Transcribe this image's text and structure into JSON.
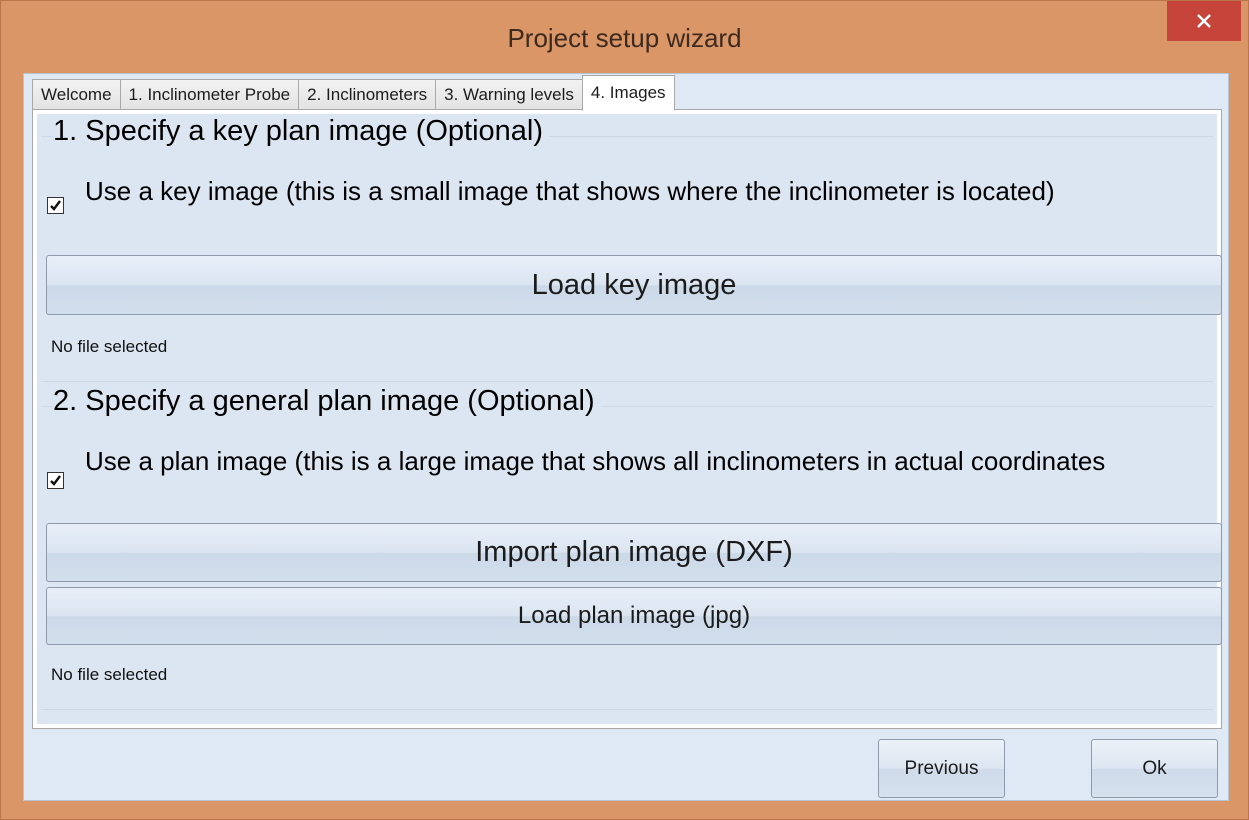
{
  "window": {
    "title": "Project setup wizard",
    "close_label": "×"
  },
  "tabs": [
    {
      "label": "Welcome",
      "active": false
    },
    {
      "label": "1. Inclinometer Probe",
      "active": false
    },
    {
      "label": "2. Inclinometers",
      "active": false
    },
    {
      "label": "3. Warning levels",
      "active": false
    },
    {
      "label": "4. Images",
      "active": true
    }
  ],
  "key_plan": {
    "title": "1. Specify a key plan image (Optional)",
    "checkbox_checked": true,
    "checkbox_label": "Use a key image (this is a small image that shows where the inclinometer is located)",
    "load_button": "Load key image",
    "status": "No file selected"
  },
  "general_plan": {
    "title": "2. Specify a general plan image (Optional)",
    "checkbox_checked": true,
    "checkbox_label": "Use a plan image (this is a large image that shows all inclinometers in actual coordinates",
    "import_button": "Import plan image (DXF)",
    "load_button": "Load plan image (jpg)",
    "status": "No file selected"
  },
  "footer": {
    "previous_label": "Previous",
    "ok_label": "Ok"
  },
  "colors": {
    "frame": "#db9668",
    "close_button": "#c7443a",
    "client_bg": "#dfe9f5"
  }
}
